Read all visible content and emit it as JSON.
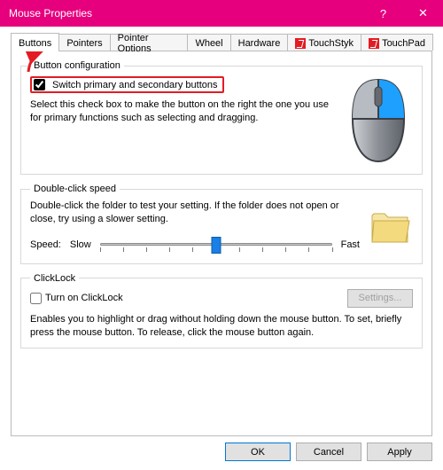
{
  "window": {
    "title": "Mouse Properties",
    "help_glyph": "?",
    "close_glyph": "✕"
  },
  "tabs": {
    "items": [
      {
        "label": "Buttons",
        "active": true
      },
      {
        "label": "Pointers"
      },
      {
        "label": "Pointer Options"
      },
      {
        "label": "Wheel"
      },
      {
        "label": "Hardware"
      },
      {
        "label": "TouchStyk",
        "icon": true
      },
      {
        "label": "TouchPad",
        "icon": true
      }
    ]
  },
  "button_config": {
    "legend": "Button configuration",
    "switch_label": "Switch primary and secondary buttons",
    "switch_checked": true,
    "desc": "Select this check box to make the button on the right the one you use for primary functions such as selecting and dragging."
  },
  "double_click": {
    "legend": "Double-click speed",
    "desc": "Double-click the folder to test your setting. If the folder does not open or close, try using a slower setting.",
    "speed_label": "Speed:",
    "slow_label": "Slow",
    "fast_label": "Fast",
    "slider": {
      "min": 0,
      "max": 10,
      "value": 5
    }
  },
  "clicklock": {
    "legend": "ClickLock",
    "turn_on_label": "Turn on ClickLock",
    "turn_on_checked": false,
    "settings_label": "Settings...",
    "settings_enabled": false,
    "desc": "Enables you to highlight or drag without holding down the mouse button. To set, briefly press the mouse button. To release, click the mouse button again."
  },
  "footer": {
    "ok": "OK",
    "cancel": "Cancel",
    "apply": "Apply"
  }
}
